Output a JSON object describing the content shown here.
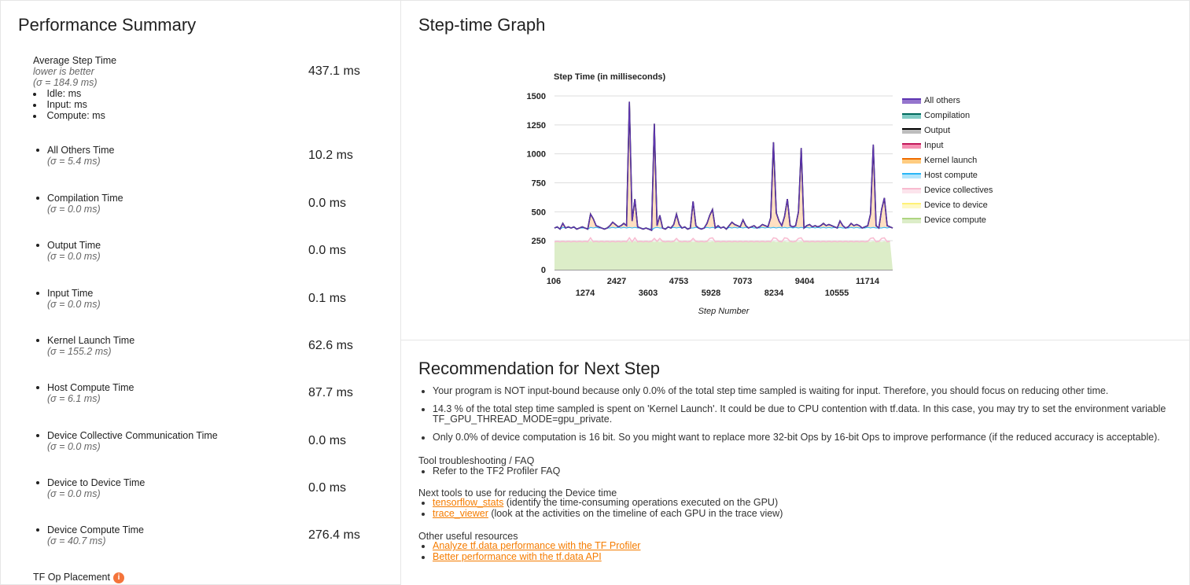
{
  "perf": {
    "title": "Performance Summary",
    "avg": {
      "label": "Average Step Time",
      "hint": "lower is better",
      "sigma": "(σ = 184.9 ms)",
      "value": "437.1 ms",
      "bullets": [
        "Idle: ms",
        "Input: ms",
        "Compute: ms"
      ]
    },
    "metrics": [
      {
        "label": "All Others Time",
        "sigma": "(σ = 5.4 ms)",
        "value": "10.2 ms"
      },
      {
        "label": "Compilation Time",
        "sigma": "(σ = 0.0 ms)",
        "value": "0.0 ms"
      },
      {
        "label": "Output Time",
        "sigma": "(σ = 0.0 ms)",
        "value": "0.0 ms"
      },
      {
        "label": "Input Time",
        "sigma": "(σ = 0.0 ms)",
        "value": "0.1 ms"
      },
      {
        "label": "Kernel Launch Time",
        "sigma": "(σ = 155.2 ms)",
        "value": "62.6 ms"
      },
      {
        "label": "Host Compute Time",
        "sigma": "(σ = 6.1 ms)",
        "value": "87.7 ms"
      },
      {
        "label": "Device Collective Communication Time",
        "sigma": "(σ = 0.0 ms)",
        "value": "0.0 ms"
      },
      {
        "label": "Device to Device Time",
        "sigma": "(σ = 0.0 ms)",
        "value": "0.0 ms"
      },
      {
        "label": "Device Compute Time",
        "sigma": "(σ = 40.7 ms)",
        "value": "276.4 ms"
      }
    ],
    "tf_op": {
      "label": "TF Op Placement",
      "info_icon": "i"
    }
  },
  "graph": {
    "title": "Step-time Graph"
  },
  "chart_data": {
    "type": "area",
    "title": "Step Time (in milliseconds)",
    "xlabel": "Step Number",
    "ylabel": "",
    "ylim": [
      0,
      1500
    ],
    "yticks": [
      "0",
      "250",
      "500",
      "750",
      "1000",
      "1250",
      "1500"
    ],
    "xticks_top": [
      "106",
      "2427",
      "4753",
      "7073",
      "9404",
      "11714"
    ],
    "xticks_bottom": [
      "1274",
      "3603",
      "5928",
      "8234",
      "10555"
    ],
    "legend": [
      {
        "name": "All others",
        "color": "#9575cd",
        "line": "#5e35b1"
      },
      {
        "name": "Compilation",
        "color": "#80cbc4",
        "line": "#00695c"
      },
      {
        "name": "Output",
        "color": "#bdbdbd",
        "line": "#000000"
      },
      {
        "name": "Input",
        "color": "#f48fb1",
        "line": "#c2185b"
      },
      {
        "name": "Kernel launch",
        "color": "#ffcc80",
        "line": "#ef6c00"
      },
      {
        "name": "Host compute",
        "color": "#b3e5fc",
        "line": "#29b6f6"
      },
      {
        "name": "Device collectives",
        "color": "#fce4ec",
        "line": "#f8bbd0"
      },
      {
        "name": "Device to device",
        "color": "#fff9c4",
        "line": "#fff176"
      },
      {
        "name": "Device compute",
        "color": "#dcedc8",
        "line": "#aed581"
      }
    ],
    "series_total": [
      360,
      370,
      350,
      400,
      360,
      370,
      360,
      370,
      350,
      360,
      370,
      360,
      350,
      480,
      440,
      380,
      370,
      360,
      350,
      360,
      380,
      410,
      390,
      370,
      380,
      400,
      380,
      1450,
      420,
      610,
      370,
      360,
      350,
      360,
      350,
      340,
      1260,
      380,
      470,
      360,
      350,
      370,
      360,
      390,
      480,
      390,
      360,
      370,
      350,
      360,
      590,
      380,
      360,
      350,
      360,
      400,
      470,
      520,
      360,
      380,
      360,
      370,
      350,
      380,
      410,
      390,
      380,
      370,
      430,
      380,
      360,
      370,
      380,
      360,
      370,
      390,
      380,
      370,
      450,
      1100,
      490,
      420,
      380,
      460,
      610,
      380,
      370,
      380,
      500,
      1050,
      360,
      380,
      390,
      370,
      380,
      370,
      380,
      400,
      380,
      390,
      380,
      370,
      360,
      420,
      380,
      360,
      370,
      400,
      380,
      390,
      380,
      360,
      370,
      380,
      480,
      1080,
      380,
      360,
      520,
      620,
      380,
      370,
      360
    ],
    "series_device": [
      240,
      245,
      240,
      245,
      240,
      245,
      240,
      245,
      240,
      245,
      240,
      245,
      240,
      245,
      240,
      245,
      240,
      245,
      240,
      245,
      240,
      245,
      240,
      245,
      240,
      245,
      240,
      245,
      240,
      245,
      240,
      245,
      240,
      245,
      240,
      245,
      240,
      245,
      240,
      245,
      240,
      245,
      240,
      245,
      240,
      245,
      240,
      245,
      240,
      245,
      240,
      245,
      240,
      245,
      240,
      245,
      240,
      245,
      240,
      245,
      240,
      245,
      240,
      245,
      240,
      245,
      240,
      245,
      240,
      245,
      240,
      245,
      240,
      245,
      240,
      245,
      240,
      245,
      240,
      245,
      240,
      245,
      240,
      245,
      240,
      245,
      240,
      245,
      240,
      245,
      240,
      245,
      240,
      245,
      240,
      245,
      240,
      245,
      240,
      245,
      240,
      245,
      240,
      245,
      240,
      245,
      240,
      245,
      240,
      245,
      240,
      245,
      240,
      245,
      240,
      245,
      240,
      245,
      240,
      245,
      240,
      245
    ]
  },
  "rec": {
    "title": "Recommendation for Next Step",
    "items": [
      "Your program is NOT input-bound because only 0.0% of the total step time sampled is waiting for input. Therefore, you should focus on reducing other time.",
      "14.3 % of the total step time sampled is spent on 'Kernel Launch'. It could be due to CPU contention with tf.data. In this case, you may try to set the environment variable TF_GPU_THREAD_MODE=gpu_private.",
      "Only 0.0% of device computation is 16 bit. So you might want to replace more 32-bit Ops by 16-bit Ops to improve performance (if the reduced accuracy is acceptable)."
    ],
    "faq_head": "Tool troubleshooting / FAQ",
    "faq_item": "Refer to the TF2 Profiler FAQ",
    "next_head": "Next tools to use for reducing the Device time",
    "next_tools": [
      {
        "link": "tensorflow_stats",
        "desc": " (identify the time-consuming operations executed on the GPU)"
      },
      {
        "link": "trace_viewer",
        "desc": " (look at the activities on the timeline of each GPU in the trace view)"
      }
    ],
    "other_head": "Other useful resources",
    "other_links": [
      "Analyze tf.data performance with the TF Profiler",
      "Better performance with the tf.data API"
    ]
  }
}
